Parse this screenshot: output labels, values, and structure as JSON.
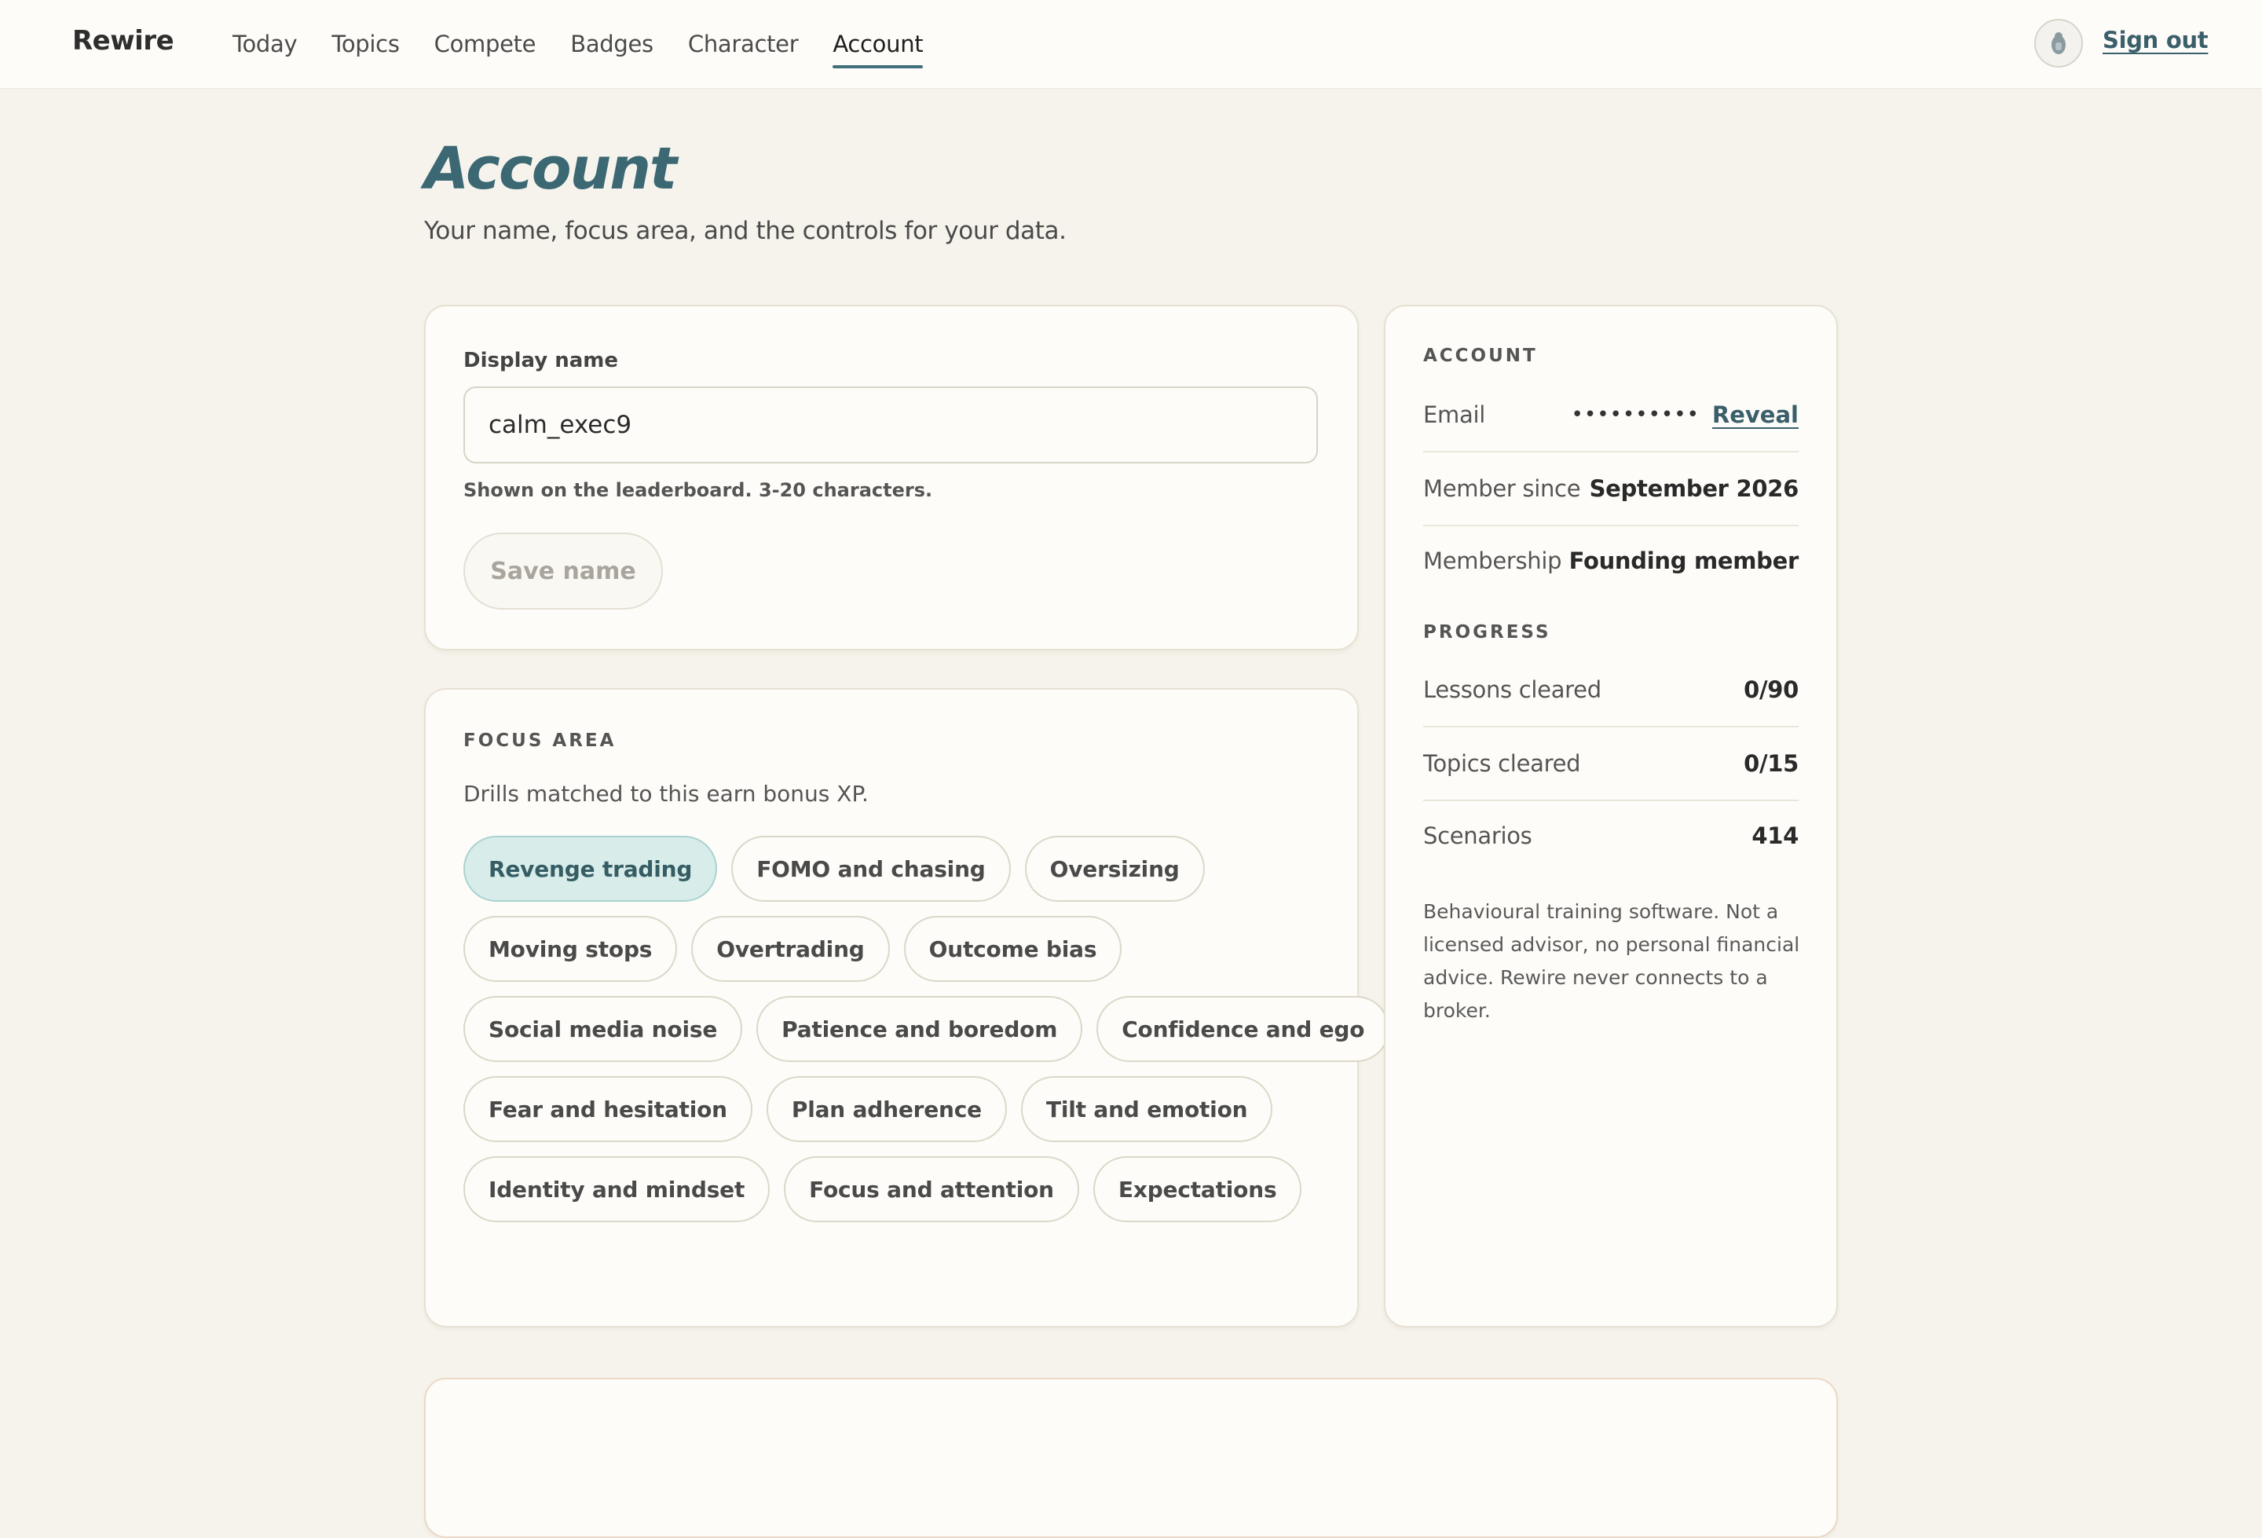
{
  "app": {
    "brand": "Rewire"
  },
  "nav": {
    "items": [
      "Today",
      "Topics",
      "Compete",
      "Badges",
      "Character",
      "Account"
    ],
    "active": "Account",
    "sign_out": "Sign out",
    "avatar_icon": "avatar-icon"
  },
  "page": {
    "title": "Account",
    "subtitle": "Your name, focus area, and the controls for your data."
  },
  "name_card": {
    "label": "Display name",
    "value": "calm_exec9",
    "helper": "Shown on the leaderboard. 3-20 characters.",
    "save_label": "Save name"
  },
  "focus": {
    "heading": "FOCUS AREA",
    "description": "Drills matched to this earn bonus XP.",
    "selected": "Revenge trading",
    "chips": [
      [
        "Revenge trading",
        "FOMO and chasing",
        "Oversizing"
      ],
      [
        "Moving stops",
        "Overtrading",
        "Outcome bias"
      ],
      [
        "Social media noise",
        "Patience and boredom",
        "Confidence and ego"
      ],
      [
        "Fear and hesitation",
        "Plan adherence",
        "Tilt and emotion"
      ],
      [
        "Identity and mindset",
        "Focus and attention",
        "Expectations"
      ]
    ]
  },
  "account": {
    "heading": "ACCOUNT",
    "email_label": "Email",
    "email_masked": "••••••••••",
    "reveal": "Reveal",
    "member_since_label": "Member since",
    "member_since": "September 2026",
    "membership_label": "Membership",
    "membership": "Founding member"
  },
  "progress": {
    "heading": "PROGRESS",
    "lessons_label": "Lessons cleared",
    "lessons": "0/90",
    "topics_label": "Topics cleared",
    "topics": "0/15",
    "scenarios_label": "Scenarios",
    "scenarios": "414"
  },
  "disclaimer": "Behavioural training software. Not a licensed advisor, no personal financial advice. Rewire never connects to a broker.",
  "colors": {
    "accent": "#3c6874",
    "selected_chip": "#d8ecea",
    "background": "#f6f3ec"
  }
}
